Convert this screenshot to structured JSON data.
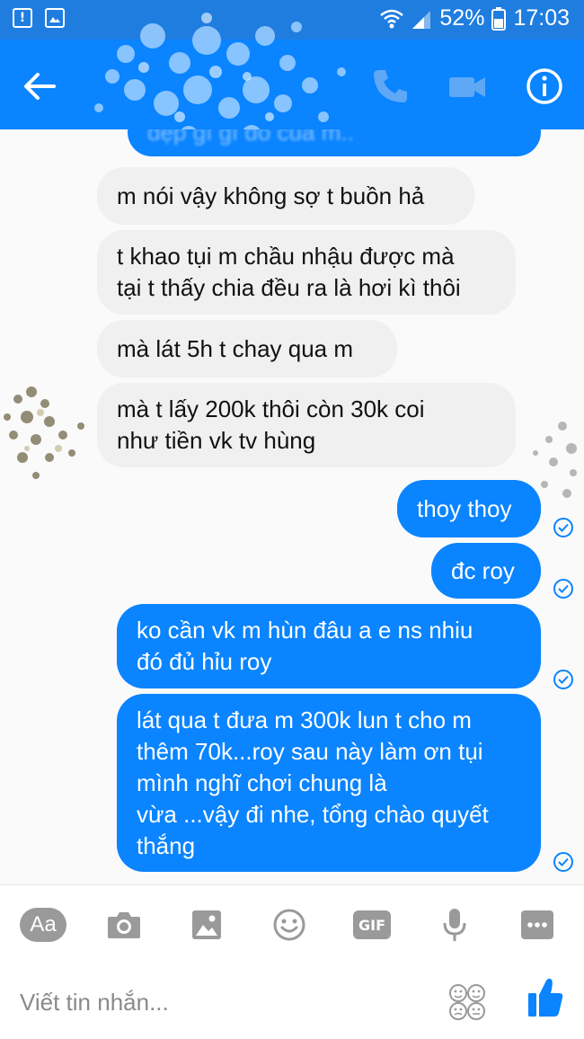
{
  "status_bar": {
    "battery": "52%",
    "time": "17:03"
  },
  "header": {
    "contact_name": ""
  },
  "messages": [
    {
      "side": "out",
      "text": "đẹp gì gì đó của m..",
      "status": "seen"
    },
    {
      "side": "in",
      "text": "m nói vậy không sợ t buồn hả"
    },
    {
      "side": "in",
      "text": "t khao tụi m chầu nhậu được mà\ntại t thấy chia đều ra là hơi kì thôi"
    },
    {
      "side": "in",
      "text": "mà lát 5h t chay qua m"
    },
    {
      "side": "in",
      "text": "mà t lấy 200k thôi còn 30k coi\nnhư tiền vk tv hùng"
    },
    {
      "side": "out",
      "text": "thoy thoy",
      "status": "sent"
    },
    {
      "side": "out",
      "text": "đc roy",
      "status": "sent"
    },
    {
      "side": "out",
      "text": "ko cần vk m hùn đâu a e ns nhiu\nđó đủ hỉu roy",
      "status": "sent"
    },
    {
      "side": "out",
      "text": "lát qua t đưa m 300k lun t cho m\nthêm 70k...roy sau này làm ơn tụi\nmình nghĩ chơi chung là\nvừa ...vậy đi nhe, tổng chào quyết\nthắng",
      "status": "sent"
    }
  ],
  "composer": {
    "aa_label": "Aa",
    "gif_label": "GIF",
    "placeholder": "Viết tin nhắn..."
  },
  "icons": {
    "status": [
      "alert-icon",
      "image-icon",
      "wifi-icon",
      "signal-icon",
      "battery-icon"
    ],
    "header": [
      "back-arrow-icon",
      "phone-icon",
      "video-camera-icon",
      "info-icon"
    ],
    "toolbar": [
      "camera-icon",
      "gallery-icon",
      "emoji-icon",
      "microphone-icon",
      "more-icon",
      "sticker-icon",
      "thumbs-up-icon"
    ]
  },
  "colors": {
    "status_bar": "#1f7de0",
    "header": "#0a84ff",
    "outgoing_bubble": "#0a84ff",
    "incoming_bubble": "#f1f0f0",
    "toolbar_icon": "#9a9a9a"
  }
}
